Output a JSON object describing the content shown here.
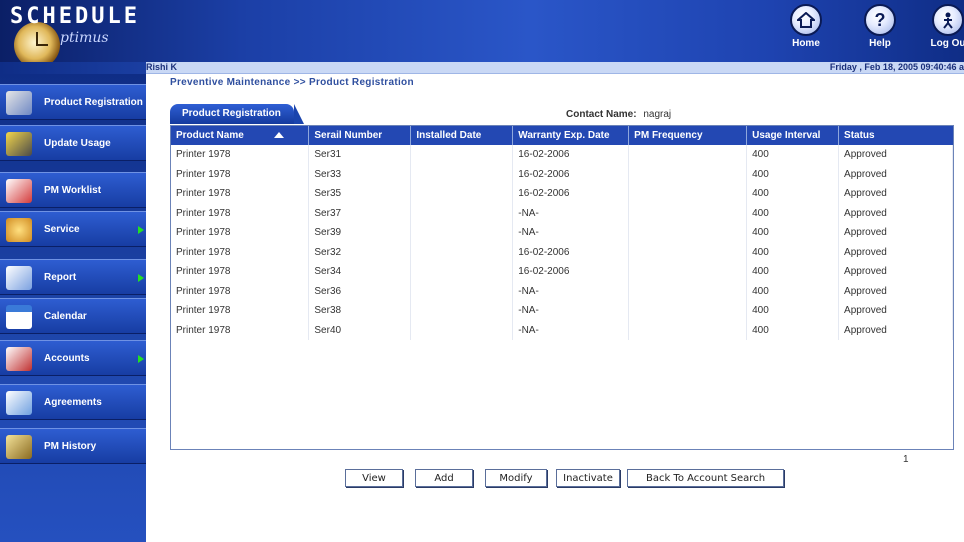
{
  "app": {
    "logo": "SCHEDULE",
    "logo_sub": "ptimus",
    "user": "Rishi K",
    "datetime": "Friday , Feb 18, 2005 09:40:46 a"
  },
  "header_buttons": [
    {
      "label": "Home",
      "icon": "home-icon"
    },
    {
      "label": "Help",
      "icon": "help-icon"
    },
    {
      "label": "Log Ou",
      "icon": "logout-icon"
    }
  ],
  "sidebar": {
    "items": [
      {
        "label": "Product Registration",
        "icon": "product-registration-icon",
        "has_submenu": false
      },
      {
        "label": "Update Usage",
        "icon": "update-usage-icon",
        "has_submenu": false
      },
      {
        "label": "PM Worklist",
        "icon": "pm-worklist-icon",
        "has_submenu": false
      },
      {
        "label": "Service",
        "icon": "service-icon",
        "has_submenu": true
      },
      {
        "label": "Report",
        "icon": "report-icon",
        "has_submenu": true
      },
      {
        "label": "Calendar",
        "icon": "calendar-icon",
        "has_submenu": false
      },
      {
        "label": "Accounts",
        "icon": "accounts-icon",
        "has_submenu": true
      },
      {
        "label": "Agreements",
        "icon": "agreements-icon",
        "has_submenu": false
      },
      {
        "label": "PM History",
        "icon": "pm-history-icon",
        "has_submenu": false
      }
    ]
  },
  "main": {
    "breadcrumb": "Preventive Maintenance >> Product Registration",
    "tab": "Product Registration",
    "contact_label": "Contact Name:",
    "contact_value": "nagraj",
    "columns": [
      "Product Name",
      "Serail Number",
      "Installed Date",
      "Warranty Exp. Date",
      "PM Frequency",
      "Usage Interval",
      "Status"
    ],
    "rows": [
      [
        "Printer 1978",
        "Ser31",
        "",
        "16-02-2006",
        "",
        "400",
        "Approved"
      ],
      [
        "Printer 1978",
        "Ser33",
        "",
        "16-02-2006",
        "",
        "400",
        "Approved"
      ],
      [
        "Printer 1978",
        "Ser35",
        "",
        "16-02-2006",
        "",
        "400",
        "Approved"
      ],
      [
        "Printer 1978",
        "Ser37",
        "",
        "-NA-",
        "",
        "400",
        "Approved"
      ],
      [
        "Printer 1978",
        "Ser39",
        "",
        "-NA-",
        "",
        "400",
        "Approved"
      ],
      [
        "Printer 1978",
        "Ser32",
        "",
        "16-02-2006",
        "",
        "400",
        "Approved"
      ],
      [
        "Printer 1978",
        "Ser34",
        "",
        "16-02-2006",
        "",
        "400",
        "Approved"
      ],
      [
        "Printer 1978",
        "Ser36",
        "",
        "-NA-",
        "",
        "400",
        "Approved"
      ],
      [
        "Printer 1978",
        "Ser38",
        "",
        "-NA-",
        "",
        "400",
        "Approved"
      ],
      [
        "Printer 1978",
        "Ser40",
        "",
        "-NA-",
        "",
        "400",
        "Approved"
      ]
    ],
    "page_number": "1",
    "buttons": {
      "view": "View",
      "add": "Add",
      "modify": "Modify",
      "inactivate": "Inactivate",
      "back": "Back To Account Search"
    }
  },
  "colors": {
    "header_blue": "#1b3fa6",
    "table_header": "#2348b3",
    "submenu_arrow": "#22e022"
  }
}
